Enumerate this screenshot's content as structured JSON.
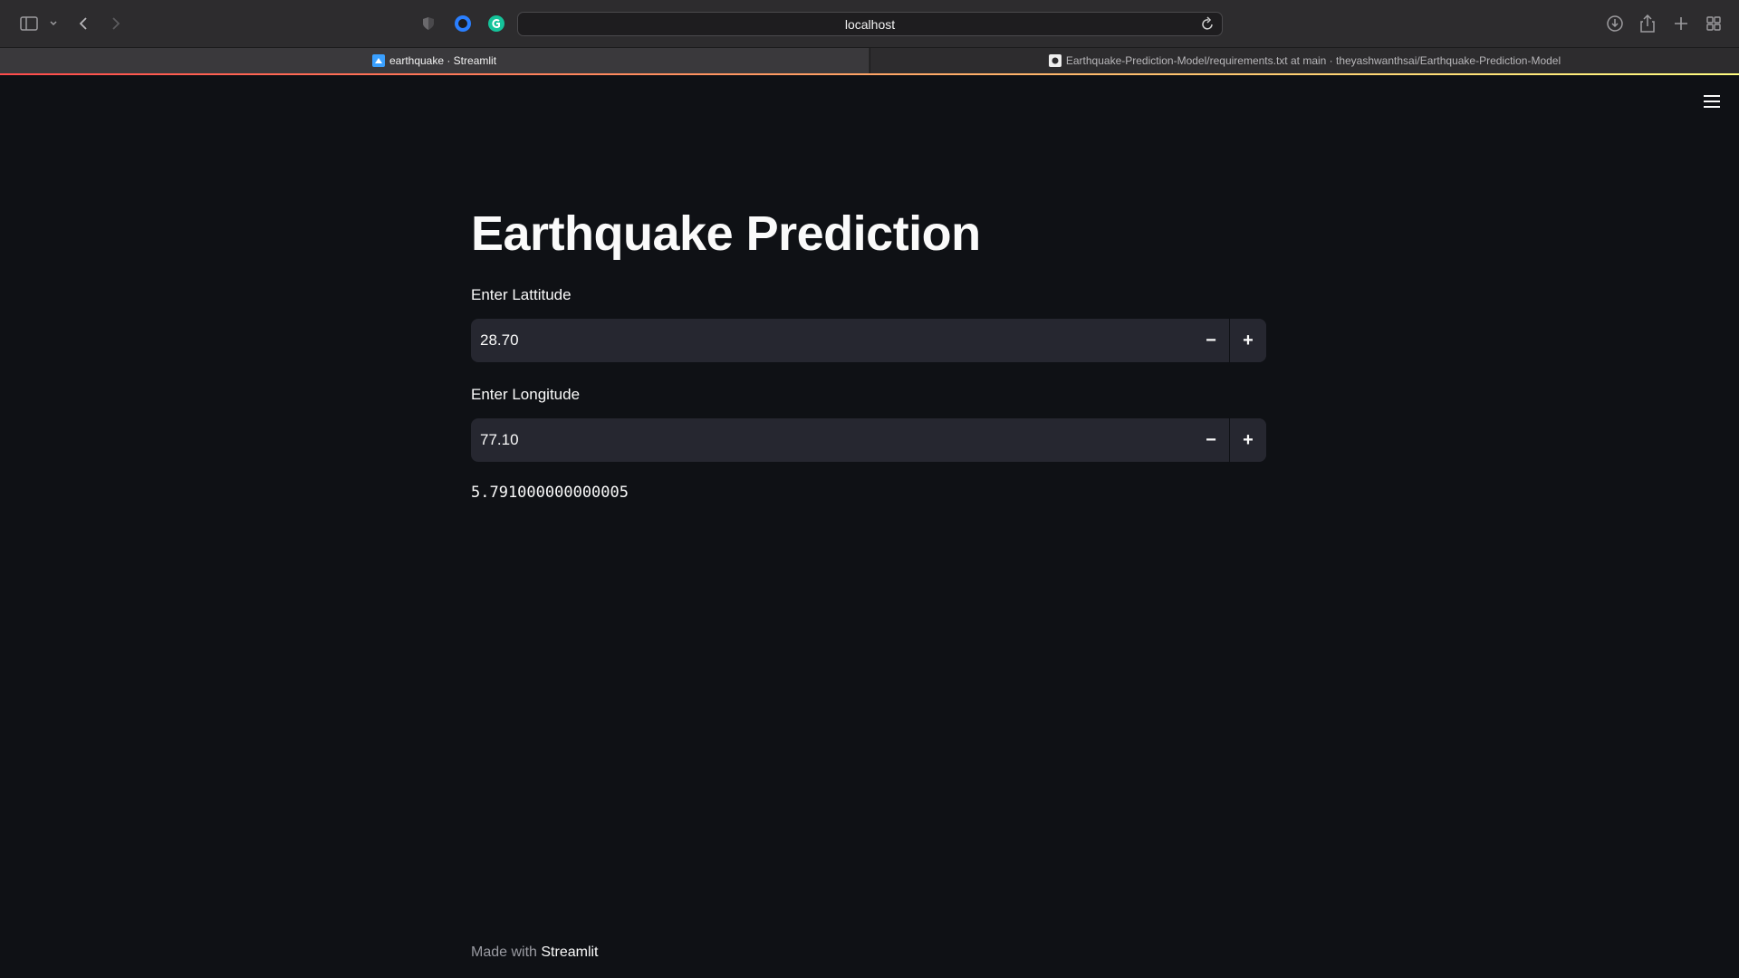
{
  "browser": {
    "url": "localhost",
    "tabs": [
      {
        "label": "earthquake · Streamlit",
        "active": true,
        "favicon": "streamlit-icon"
      },
      {
        "label": "Earthquake-Prediction-Model/requirements.txt at main · theyashwanthsai/Earthquake-Prediction-Model",
        "active": false,
        "favicon": "github-icon"
      }
    ]
  },
  "app": {
    "title": "Earthquake Prediction",
    "latitude": {
      "label": "Enter Lattitude",
      "value": "28.70",
      "decrement": "−",
      "increment": "+"
    },
    "longitude": {
      "label": "Enter Longitude",
      "value": "77.10",
      "decrement": "−",
      "increment": "+"
    },
    "result": "5.791000000000005",
    "footer": {
      "prefix": "Made with",
      "brand": "Streamlit"
    }
  },
  "colors": {
    "background": "#0f1115",
    "input_background": "#262730",
    "accent_gradient_start": "#ff4b4b",
    "accent_gradient_end": "#fffd80"
  }
}
